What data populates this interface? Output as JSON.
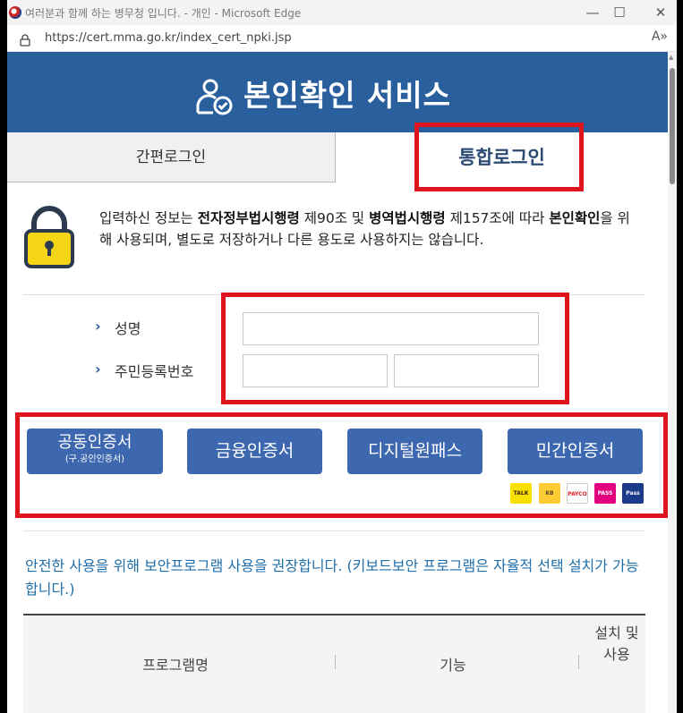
{
  "window": {
    "title": "여러분과 함께 하는 병무청 입니다. - 개인 - Microsoft Edge",
    "controls": {
      "minimize": "—",
      "maximize": "☐",
      "close": "✕"
    }
  },
  "address_bar": {
    "url": "https://cert.mma.go.kr/index_cert_npki.jsp",
    "read_aloud": "A»"
  },
  "banner": {
    "title": "본인확인 서비스"
  },
  "tabs": {
    "simple_login": "간편로그인",
    "integrated_login": "통합로그인"
  },
  "notice": {
    "p1": "입력하신 정보는 ",
    "b1": "전자정부법시행령",
    "p2": " 제90조 및 ",
    "b2": "병역법시행령",
    "p3": " 제157조에 따라 ",
    "b3": "본인확인",
    "p4": "을 위해 사용되며, 별도로 저장하거나 다른 용도로 사용하지는 않습니다."
  },
  "form": {
    "name_label": "성명",
    "name_value": "",
    "rrn_label": "주민등록번호",
    "rrn_front_value": "",
    "rrn_back_value": ""
  },
  "cert_buttons": {
    "joint": {
      "label": "공동인증서",
      "sub": "(구.공인인증서)"
    },
    "financial": {
      "label": "금융인증서"
    },
    "digital": {
      "label": "디지털원패스"
    },
    "private": {
      "label": "민간인증서"
    }
  },
  "providers": {
    "kakao": {
      "label": "TALK",
      "color": "#f9e000"
    },
    "kb": {
      "label": "KB",
      "color": "#ffcc33"
    },
    "payco": {
      "label": "PAYCO",
      "color": "#ffffff"
    },
    "pass": {
      "label": "PASS",
      "color": "#e3007f"
    },
    "samsung": {
      "label": "Pass",
      "color": "#1c3a8a"
    }
  },
  "security_notice": "안전한 사용을 위해 보안프로그램 사용을 권장합니다. (키보드보안 프로그램은 자율적 선택 설치가 가능합니다.)",
  "program_table": {
    "headers": [
      "프로그램명",
      "기능",
      "설치 및 사용"
    ]
  },
  "colors": {
    "banner": "#2a5f9e",
    "button": "#3d67ae",
    "highlight": "#e0141e",
    "link_text": "#1f6ea8"
  }
}
